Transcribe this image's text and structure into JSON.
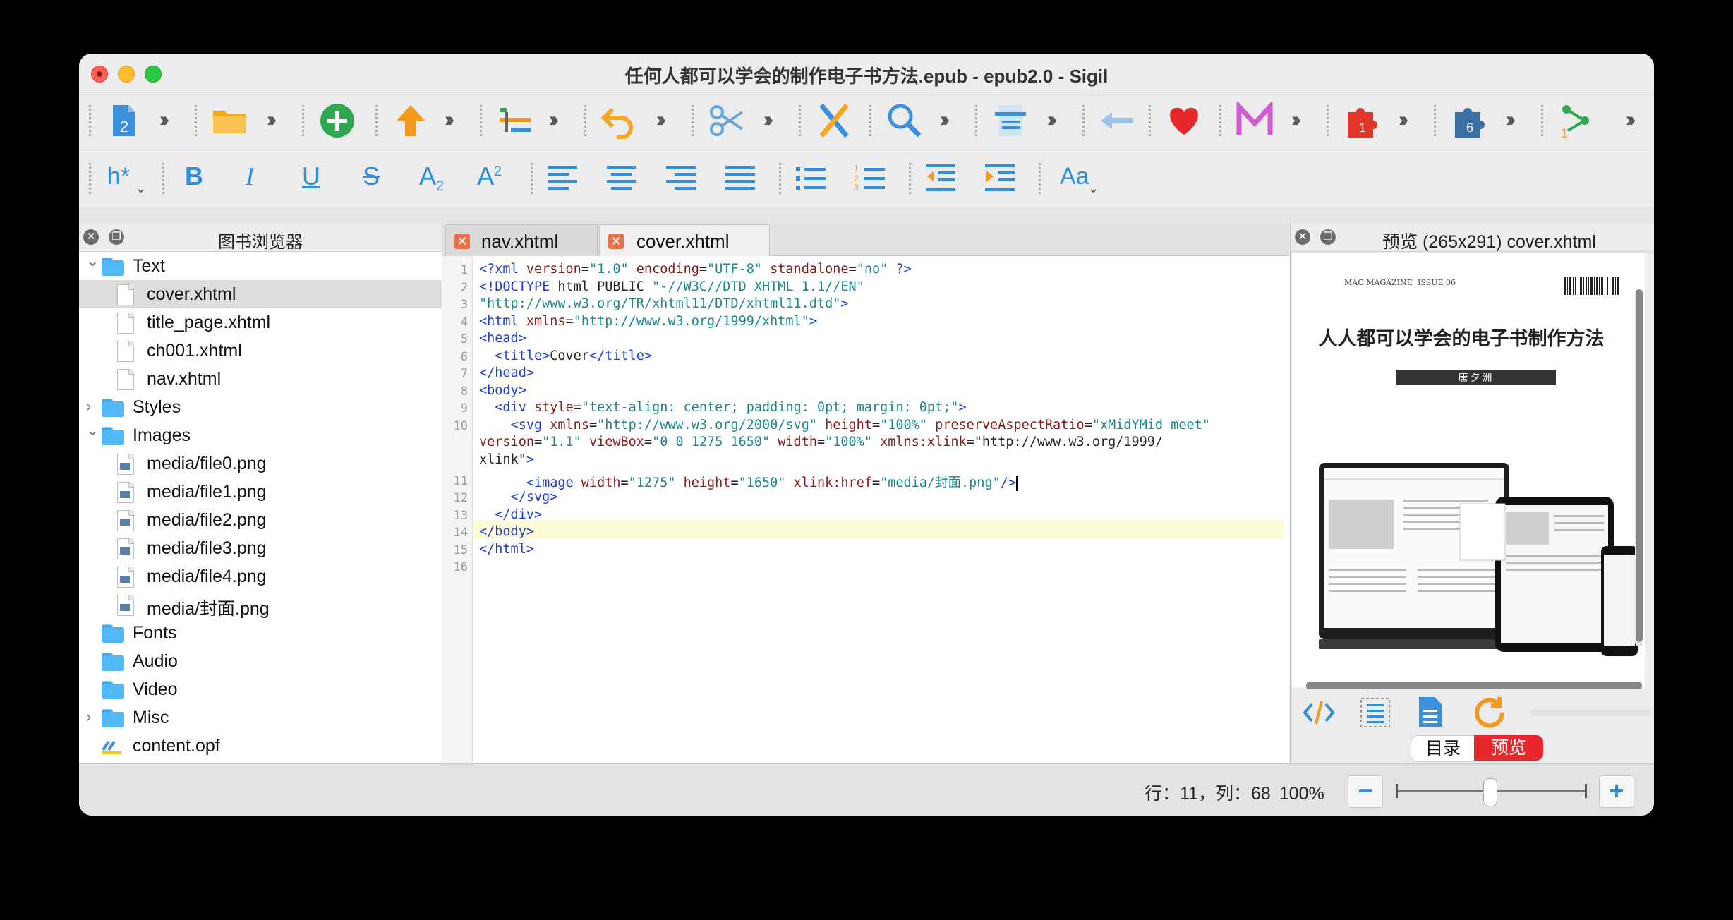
{
  "window": {
    "title": "任何人都可以学会的制作电子书方法.epub - epub2.0 - Sigil"
  },
  "toolbar1": {
    "icons": [
      "new-epub-icon",
      "open-folder-icon",
      "add-file-icon",
      "move-up-icon",
      "metadata-icon",
      "undo-icon",
      "cut-icon",
      "tools-icon",
      "find-icon",
      "toc-icon",
      "back-icon",
      "heart-icon",
      "m-icon",
      "plugin1-icon",
      "plugin6-icon",
      "checkpoint-icon"
    ],
    "new_badge": "2",
    "plugin1_badge": "1",
    "plugin6_badge": "6"
  },
  "toolbar2": {
    "heading_label": "h*",
    "bold_label": "B",
    "italic_label": "I",
    "underline_label": "U",
    "strike_label": "S",
    "sub_label": "A",
    "sub_small": "2",
    "sup_label": "A",
    "sup_small": "2",
    "case_label": "Aa"
  },
  "book_browser": {
    "title": "图书浏览器",
    "items": [
      {
        "label": "Text",
        "type": "folder",
        "expanded": true
      },
      {
        "label": "cover.xhtml",
        "type": "file",
        "selected": true
      },
      {
        "label": "title_page.xhtml",
        "type": "file"
      },
      {
        "label": "ch001.xhtml",
        "type": "file"
      },
      {
        "label": "nav.xhtml",
        "type": "file"
      },
      {
        "label": "Styles",
        "type": "folder",
        "expanded": false
      },
      {
        "label": "Images",
        "type": "folder",
        "expanded": true
      },
      {
        "label": "media/file0.png",
        "type": "image"
      },
      {
        "label": "media/file1.png",
        "type": "image"
      },
      {
        "label": "media/file2.png",
        "type": "image"
      },
      {
        "label": "media/file3.png",
        "type": "image"
      },
      {
        "label": "media/file4.png",
        "type": "image"
      },
      {
        "label": "media/封面.png",
        "type": "image"
      },
      {
        "label": "Fonts",
        "type": "folder"
      },
      {
        "label": "Audio",
        "type": "folder"
      },
      {
        "label": "Video",
        "type": "folder"
      },
      {
        "label": "Misc",
        "type": "folder",
        "expanded": false
      },
      {
        "label": "content.opf",
        "type": "opf"
      }
    ]
  },
  "tabs": [
    {
      "label": "nav.xhtml",
      "active": false
    },
    {
      "label": "cover.xhtml",
      "active": true
    }
  ],
  "editor": {
    "line_numbers": [
      "1",
      "2",
      "3",
      "4",
      "5",
      "6",
      "7",
      "8",
      "9",
      "10",
      "",
      "",
      "11",
      "12",
      "13",
      "14",
      "15",
      "16"
    ],
    "lines": [
      "<?xml version=\"1.0\" encoding=\"UTF-8\" standalone=\"no\" ?>",
      "<!DOCTYPE html PUBLIC \"-//W3C//DTD XHTML 1.1//EN\"",
      "\"http://www.w3.org/TR/xhtml11/DTD/xhtml11.dtd\">",
      "<html xmlns=\"http://www.w3.org/1999/xhtml\">",
      "<head>",
      "  <title>Cover</title>",
      "</head>",
      "<body>",
      "  <div style=\"text-align: center; padding: 0pt; margin: 0pt;\">",
      "    <svg xmlns=\"http://www.w3.org/2000/svg\" height=\"100%\" preserveAspectRatio=\"xMidYMid meet\"",
      "version=\"1.1\" viewBox=\"0 0 1275 1650\" width=\"100%\" xmlns:xlink=\"http://www.w3.org/1999/",
      "xlink\">",
      "      <image width=\"1275\" height=\"1650\" xlink:href=\"media/封面.png\"/>",
      "    </svg>",
      "  </div>",
      "</body>",
      "</html>",
      ""
    ]
  },
  "preview": {
    "title": "预览 (265x291) cover.xhtml",
    "magazine": "MAC MAGAZINE",
    "issue": "ISSUE 06",
    "book_title": "人人都可以学会的电子书制作方法",
    "author": "唐夕洲"
  },
  "bottom_tabs": {
    "toc": "目录",
    "preview": "预览"
  },
  "status": {
    "position": "行：11，列：68",
    "zoom": "100%",
    "zoom_minus": "−",
    "zoom_plus": "+"
  },
  "colors": {
    "accent_blue": "#2e8fe0",
    "tab_close": "#e8704a",
    "preview_tab_active": "#e8272c"
  }
}
